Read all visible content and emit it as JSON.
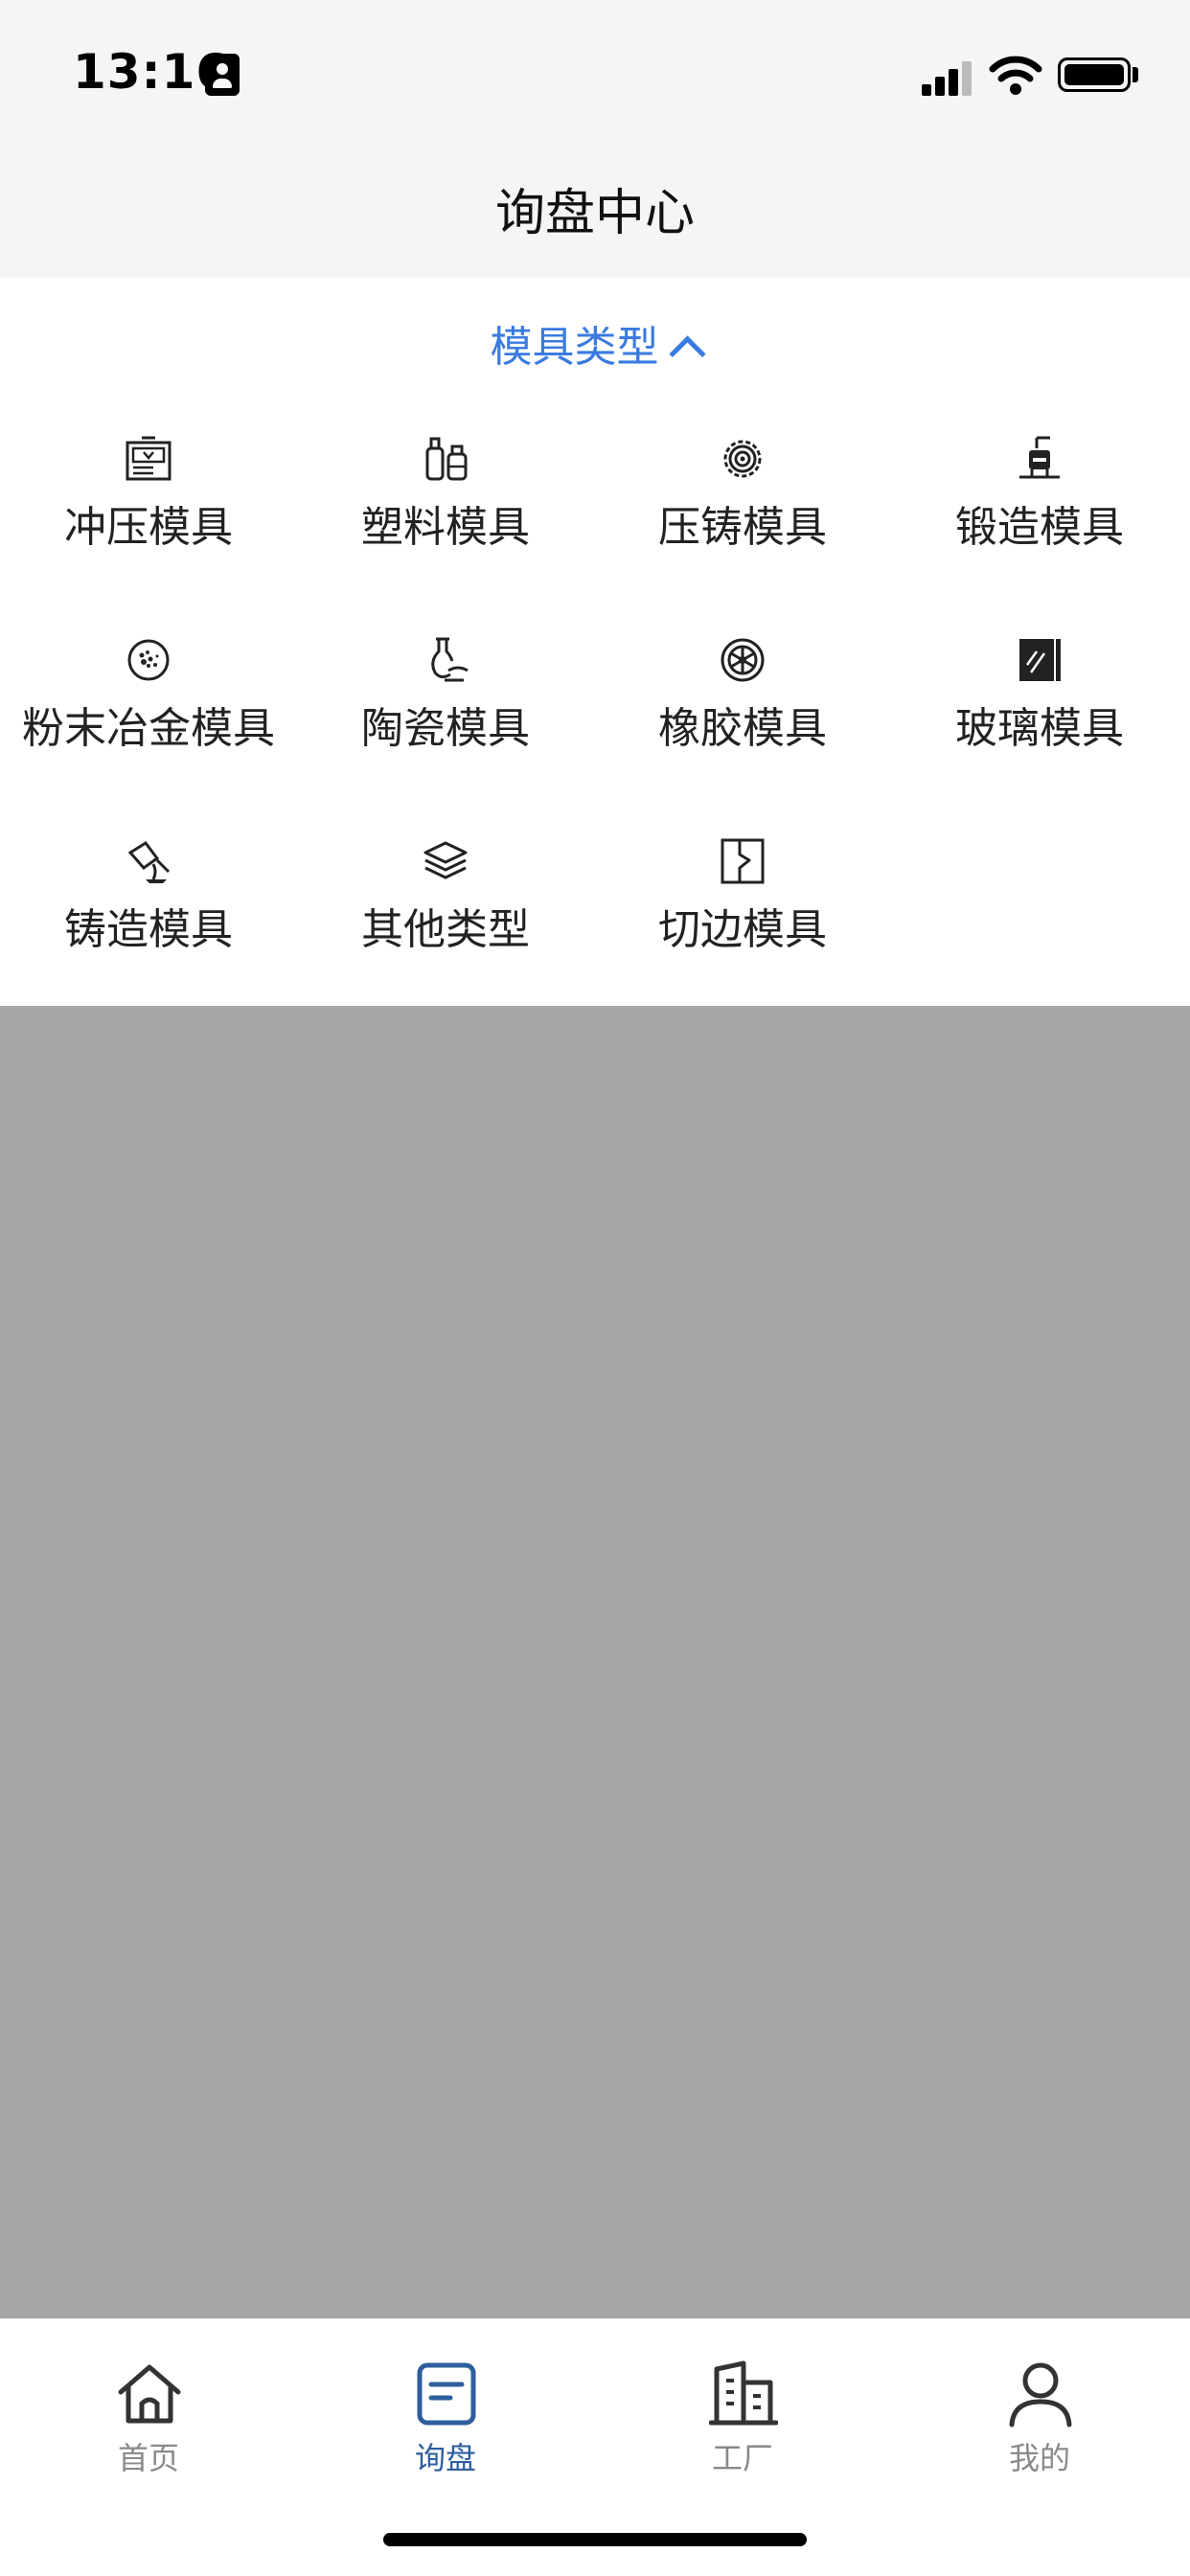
{
  "status_bar": {
    "time": "13:16"
  },
  "header": {
    "title": "询盘中心"
  },
  "filter": {
    "toggle_label": "模具类型",
    "items": [
      {
        "label": "冲压模具",
        "icon": "stamping-machine-icon"
      },
      {
        "label": "塑料模具",
        "icon": "plastic-bottles-icon"
      },
      {
        "label": "压铸模具",
        "icon": "gear-icon"
      },
      {
        "label": "锻造模具",
        "icon": "forging-press-icon"
      },
      {
        "label": "粉末冶金模具",
        "icon": "powder-icon"
      },
      {
        "label": "陶瓷模具",
        "icon": "ceramic-vase-icon"
      },
      {
        "label": "橡胶模具",
        "icon": "wheel-icon"
      },
      {
        "label": "玻璃模具",
        "icon": "glass-pane-icon"
      },
      {
        "label": "铸造模具",
        "icon": "pouring-ladle-icon"
      },
      {
        "label": "其他类型",
        "icon": "layers-icon"
      },
      {
        "label": "切边模具",
        "icon": "trim-die-icon"
      }
    ]
  },
  "tabbar": {
    "tabs": [
      {
        "label": "首页",
        "icon": "home-icon",
        "active": false
      },
      {
        "label": "询盘",
        "icon": "inquiry-doc-icon",
        "active": true
      },
      {
        "label": "工厂",
        "icon": "factory-building-icon",
        "active": false
      },
      {
        "label": "我的",
        "icon": "profile-icon",
        "active": false
      }
    ]
  },
  "colors": {
    "accent": "#3a7be0",
    "tab_active": "#2e5e9e",
    "tab_inactive": "#8a8a8a",
    "overlay": "#a7a7a7",
    "header_bg": "#f5f5f5"
  }
}
